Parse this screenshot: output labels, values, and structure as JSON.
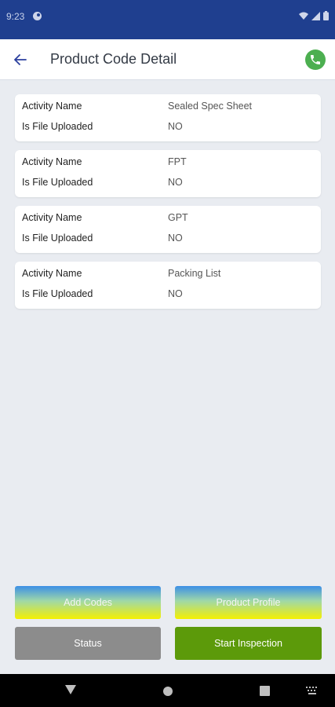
{
  "status_bar": {
    "time": "9:23"
  },
  "header": {
    "title": "Product Code Detail"
  },
  "cards": [
    {
      "rows": [
        {
          "label": "Activity Name",
          "value": "Sealed Spec Sheet"
        },
        {
          "label": "Is File Uploaded",
          "value": "NO"
        }
      ]
    },
    {
      "rows": [
        {
          "label": "Activity Name",
          "value": "FPT"
        },
        {
          "label": "Is File Uploaded",
          "value": "NO"
        }
      ]
    },
    {
      "rows": [
        {
          "label": "Activity Name",
          "value": "GPT"
        },
        {
          "label": "Is File Uploaded",
          "value": "NO"
        }
      ]
    },
    {
      "rows": [
        {
          "label": "Activity Name",
          "value": "Packing List"
        },
        {
          "label": "Is File Uploaded",
          "value": "NO"
        }
      ]
    }
  ],
  "buttons": {
    "add_codes": "Add Codes",
    "product_profile": "Product Profile",
    "status": "Status",
    "start_inspection": "Start Inspection"
  },
  "colors": {
    "status_bar": "#1f3f8f",
    "accent_green": "#5c9a0a",
    "call_green": "#4caf50",
    "neutral_button": "#8c8c8c"
  },
  "icons": [
    "back-arrow-icon",
    "phone-icon",
    "wifi-icon",
    "signal-icon",
    "battery-icon",
    "nav-back-icon",
    "nav-home-icon",
    "nav-recents-icon",
    "keyboard-icon"
  ]
}
